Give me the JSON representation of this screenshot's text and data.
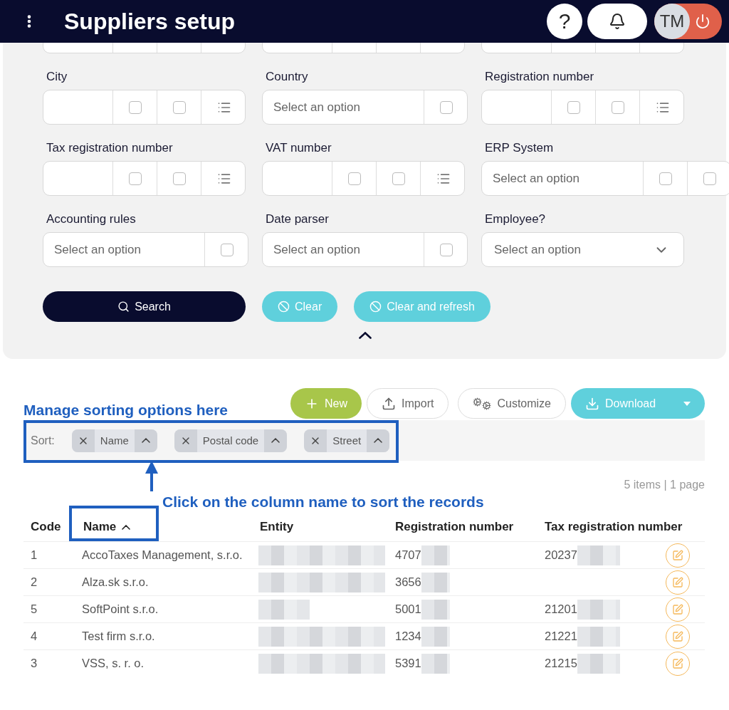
{
  "header": {
    "title": "Suppliers setup",
    "help": "?",
    "avatar": "TM"
  },
  "filters": {
    "partial_row": [
      {
        "kind": "text"
      },
      {
        "kind": "text"
      },
      {
        "kind": "text"
      }
    ],
    "rows": [
      [
        {
          "label": "City",
          "kind": "text",
          "checks": [
            {
              "checked": false
            },
            {
              "checked": false
            }
          ]
        },
        {
          "label": "Country",
          "kind": "select",
          "placeholder": "Select an option",
          "checks": [
            {
              "checked": false
            }
          ]
        },
        {
          "label": "Registration number",
          "kind": "text",
          "checks": [
            {
              "checked": false
            },
            {
              "checked": false
            }
          ]
        }
      ],
      [
        {
          "label": "Tax registration number",
          "kind": "text",
          "checks": [
            {
              "checked": false
            },
            {
              "checked": false
            }
          ]
        },
        {
          "label": "VAT number",
          "kind": "text",
          "checks": [
            {
              "checked": false
            },
            {
              "checked": false
            }
          ]
        },
        {
          "label": "ERP System",
          "kind": "select",
          "placeholder": "Select an option",
          "checks": [
            {
              "checked": false
            },
            {
              "checked": false
            }
          ]
        }
      ],
      [
        {
          "label": "Accounting rules",
          "kind": "select",
          "placeholder": "Select an option",
          "checks": [
            {
              "checked": false
            }
          ]
        },
        {
          "label": "Date parser",
          "kind": "select",
          "placeholder": "Select an option",
          "checks": [
            {
              "checked": false
            }
          ]
        },
        {
          "label": "Employee?",
          "kind": "dropdown",
          "placeholder": "Select an option"
        }
      ]
    ]
  },
  "actions": [
    {
      "label": "Search",
      "kind": "search"
    },
    {
      "label": "Clear",
      "kind": "clear"
    },
    {
      "label": "Clear and refresh",
      "kind": "clear"
    }
  ],
  "toolbar": [
    {
      "label": "New",
      "kind": "new"
    },
    {
      "label": "Import",
      "kind": "import"
    },
    {
      "label": "Customize",
      "kind": "customize"
    },
    {
      "label": "Download",
      "kind": "download"
    }
  ],
  "annotations": {
    "sorting": "Manage sorting options here",
    "column": "Click on the column name to sort the records"
  },
  "sort": {
    "label": "Sort:",
    "chips": [
      {
        "label": "Name",
        "ascending": true
      },
      {
        "label": "Postal code",
        "ascending": true
      },
      {
        "label": "Street",
        "ascending": true
      }
    ]
  },
  "pagination": "5 items | 1 page",
  "table": {
    "columns": [
      {
        "label": "Code",
        "sorted": false
      },
      {
        "label": "Name",
        "sorted": true
      },
      {
        "label": "Entity",
        "sorted": false
      },
      {
        "label": "Registration number",
        "sorted": false
      },
      {
        "label": "Tax registration number",
        "sorted": false
      }
    ],
    "rows": [
      {
        "code": "1",
        "name": "AccoTaxes Management, s.r.o.",
        "registration_number": "4707",
        "tax_registration_number": "20237"
      },
      {
        "code": "2",
        "name": "Alza.sk s.r.o.",
        "registration_number": "3656"
      },
      {
        "code": "5",
        "name": "SoftPoint s.r.o.",
        "registration_number": "5001",
        "tax_registration_number": "21201"
      },
      {
        "code": "4",
        "name": "Test firm s.r.o.",
        "registration_number": "1234",
        "tax_registration_number": "21221"
      },
      {
        "code": "3",
        "name": "VSS, s. r. o.",
        "registration_number": "5391",
        "tax_registration_number": "21215"
      }
    ]
  }
}
